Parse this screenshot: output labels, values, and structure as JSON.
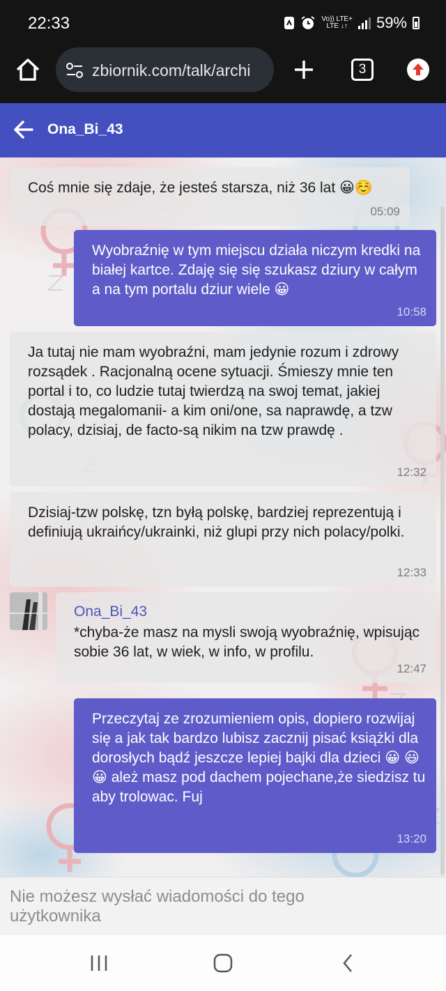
{
  "status_bar": {
    "time": "22:33",
    "network_top": "Vo)) LTE+",
    "network_bottom": "LTE ↓↑",
    "battery": "59%",
    "icons": [
      "sync-icon",
      "alarm-icon",
      "signal-icon",
      "battery-icon"
    ]
  },
  "browser": {
    "url": "zbiornik.com/talk/archi",
    "tab_count": "3",
    "icons": [
      "home-icon",
      "site-settings-icon",
      "new-tab-icon",
      "tab-switcher-icon",
      "update-icon"
    ]
  },
  "header": {
    "title": "Ona_Bi_43",
    "accent_color": "#4450c0"
  },
  "messages": [
    {
      "dir": "in",
      "text": "Coś mnie się zdaje, że jesteś starsza, niż 36 lat 😀☺️",
      "time": "05:09"
    },
    {
      "dir": "out",
      "text": "Wyobraźnię w tym miejscu działa niczym kredki na białej kartce. Zdaję się się szukasz dziury w całym a na tym portalu dziur wiele 😀",
      "time": "10:58"
    },
    {
      "dir": "in",
      "text": "Ja tutaj nie mam wyobraźni, mam jedynie rozum i zdrowy rozsądek . Racjonalną ocene sytuacji. Śmieszy mnie ten portal i to, co ludzie tutaj twierdzą na swoj temat, jakiej dostają megalomanii- a kim oni/one, sa naprawdę, a tzw polacy, dzisiaj, de facto-są nikim na tzw prawdę .",
      "time": "12:32"
    },
    {
      "dir": "in",
      "text": "Dzisiaj-tzw polskę, tzn byłą polskę, bardziej reprezentują i definiują ukraińcy/ukrainki, niż glupi przy nich polacy/polki.",
      "time": "12:33"
    },
    {
      "dir": "in",
      "sender": "Ona_Bi_43",
      "text": "*chyba-że masz na mysli swoją wyobraźnię, wpisując sobie 36 lat, w wiek, w info, w profilu.",
      "time": "12:47"
    },
    {
      "dir": "out",
      "text": "Przeczytaj ze zrozumieniem opis, dopiero rozwijaj się a jak tak bardzo lubisz zacznij pisać książki dla dorosłych bądź jeszcze lepiej bajki dla dzieci 😀 😃 😀 ależ masz pod dachem pojechane,że siedzisz tu aby trolowac. Fuj",
      "time": "13:20"
    }
  ],
  "colors": {
    "incoming_bubble": "#e6e6e6",
    "outgoing_bubble": "#5f5cc9",
    "sender_name": "#4a57b8"
  },
  "notice": "Nie możesz wysłać wiadomości do tego użytkownika",
  "nav": [
    "recent-apps-icon",
    "home-nav-icon",
    "back-nav-icon"
  ]
}
